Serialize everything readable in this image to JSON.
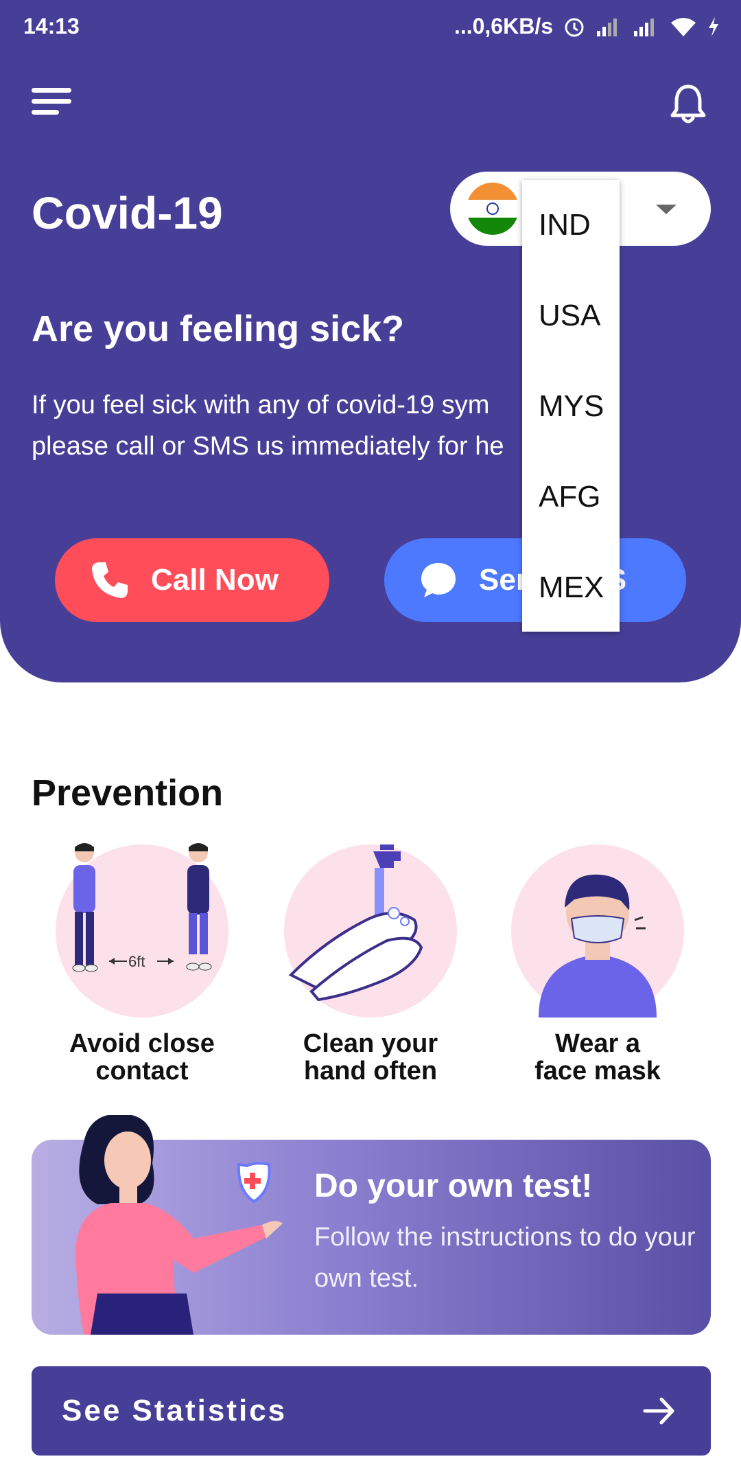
{
  "status_bar": {
    "time": "14:13",
    "network_speed": "...0,6KB/s",
    "icons": [
      "alarm-icon",
      "signal-icon",
      "wifi-icon",
      "charging-icon"
    ]
  },
  "header": {
    "title": "Covid-19",
    "country_selector": {
      "selected_flag": "india-flag",
      "options": [
        "IND",
        "USA",
        "MYS",
        "AFG",
        "MEX"
      ]
    },
    "sick": {
      "title": "Are you feeling sick?",
      "line1": "If you feel sick with any of covid-19 sym",
      "line2": "please call or SMS us immediately for he"
    },
    "call_button": "Call Now",
    "sms_button": "Send SMS"
  },
  "prevention": {
    "title": "Prevention",
    "distance_label": "6ft",
    "items": [
      {
        "line1": "Avoid close",
        "line2": "contact"
      },
      {
        "line1": "Clean your",
        "line2": "hand often"
      },
      {
        "line1": "Wear a",
        "line2": "face mask"
      }
    ]
  },
  "banner": {
    "title": "Do your own test!",
    "text": "Follow the instructions to do your own test."
  },
  "statistics_button": "See Statistics",
  "colors": {
    "primary": "#473f97",
    "call": "#ff4d5a",
    "sms": "#4d79ff",
    "prevention_circle": "#fde1ea"
  }
}
